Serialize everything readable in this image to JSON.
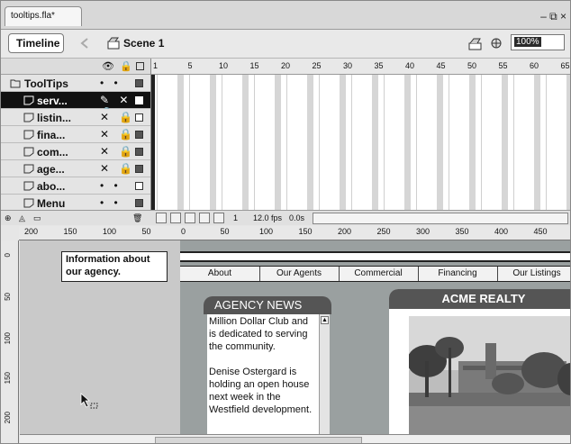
{
  "document_tab": {
    "title": "tooltips.fla*"
  },
  "window_controls": "– ⧉ ×",
  "timeline_header": {
    "timeline_button": "Timeline",
    "scene_label": "Scene 1",
    "zoom_value": "100%"
  },
  "layers": [
    {
      "name": "ToolTips",
      "type": "folder",
      "flags": "• •",
      "box": "filled"
    },
    {
      "name": "serv...",
      "type": "layer",
      "selected": true,
      "flags": "✎ ✕ 🔒",
      "box": "filled"
    },
    {
      "name": "listin...",
      "type": "layer",
      "flags": "✕ 🔒",
      "box": "empty"
    },
    {
      "name": "fina...",
      "type": "layer",
      "flags": "✕ 🔒",
      "box": "filled"
    },
    {
      "name": "com...",
      "type": "layer",
      "flags": "✕ 🔒",
      "box": "filled"
    },
    {
      "name": "age...",
      "type": "layer",
      "flags": "✕ 🔒",
      "box": "filled"
    },
    {
      "name": "abo...",
      "type": "layer",
      "flags": "• •",
      "box": "empty"
    },
    {
      "name": "Menu",
      "type": "layer",
      "flags": "• •",
      "box": "filled"
    }
  ],
  "frame_ruler": [
    "1",
    "5",
    "10",
    "15",
    "20",
    "25",
    "30",
    "35",
    "40",
    "45",
    "50",
    "55",
    "60",
    "65"
  ],
  "timeline_footer": {
    "current_frame": "1",
    "frame_rate": "12.0 fps",
    "elapsed": "0.0s"
  },
  "stage_ruler_h": [
    "200",
    "150",
    "100",
    "50",
    "0",
    "50",
    "100",
    "150",
    "200",
    "250",
    "300",
    "350",
    "400",
    "450"
  ],
  "stage_ruler_v": [
    "0",
    "50",
    "100",
    "150",
    "200"
  ],
  "stage": {
    "info_text": "Information about our agency.",
    "nav": [
      "About",
      "Our Agents",
      "Commercial",
      "Financing",
      "Our Listings"
    ],
    "news_title": "AGENCY NEWS",
    "news_body": "Million Dollar Club and is dedicated to serving the community.\n\nDenise Ostergard is holding an open house next week in the Westfield development.",
    "realty_title": "ACME REALTY"
  }
}
